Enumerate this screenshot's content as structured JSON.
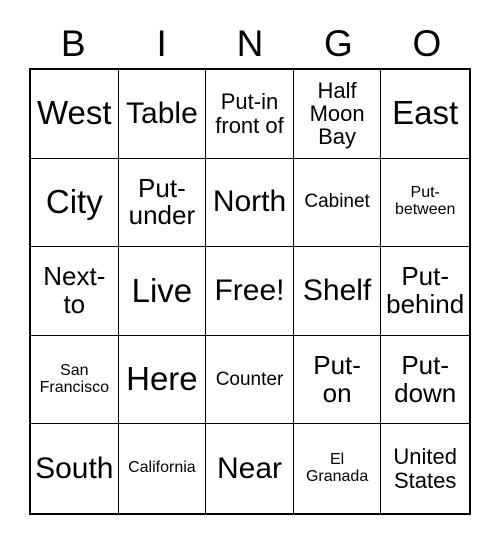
{
  "header": {
    "letters": [
      "B",
      "I",
      "N",
      "G",
      "O"
    ]
  },
  "grid": {
    "rows": [
      [
        {
          "text": "West",
          "size": "s-xl"
        },
        {
          "text": "Table",
          "size": "s-lg"
        },
        {
          "text": "Put-in\nfront of",
          "size": "s-sm"
        },
        {
          "text": "Half\nMoon\nBay",
          "size": "s-sm"
        },
        {
          "text": "East",
          "size": "s-xl"
        }
      ],
      [
        {
          "text": "City",
          "size": "s-xl"
        },
        {
          "text": "Put-\nunder",
          "size": "s-md"
        },
        {
          "text": "North",
          "size": "s-lg"
        },
        {
          "text": "Cabinet",
          "size": "s-xs"
        },
        {
          "text": "Put-\nbetween",
          "size": "s-xxs"
        }
      ],
      [
        {
          "text": "Next-\nto",
          "size": "s-md"
        },
        {
          "text": "Live",
          "size": "s-xl"
        },
        {
          "text": "Free!",
          "size": "s-lg"
        },
        {
          "text": "Shelf",
          "size": "s-lg"
        },
        {
          "text": "Put-\nbehind",
          "size": "s-md"
        }
      ],
      [
        {
          "text": "San\nFrancisco",
          "size": "s-xxs"
        },
        {
          "text": "Here",
          "size": "s-xl"
        },
        {
          "text": "Counter",
          "size": "s-xs"
        },
        {
          "text": "Put-\non",
          "size": "s-md"
        },
        {
          "text": "Put-\ndown",
          "size": "s-md"
        }
      ],
      [
        {
          "text": "South",
          "size": "s-lg"
        },
        {
          "text": "California",
          "size": "s-xxs"
        },
        {
          "text": "Near",
          "size": "s-lg"
        },
        {
          "text": "El\nGranada",
          "size": "s-xxs"
        },
        {
          "text": "United\nStates",
          "size": "s-sm"
        }
      ]
    ]
  },
  "colors": {
    "background": "#ffffff",
    "text": "#000000",
    "grid_line": "#000000"
  }
}
